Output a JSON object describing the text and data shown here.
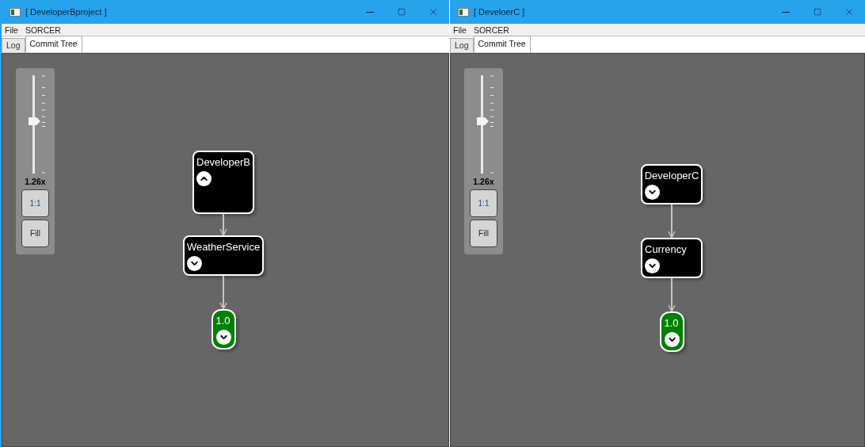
{
  "windows": [
    {
      "title": "[ DeveloperBproject ]",
      "menu": [
        "File",
        "SORCER"
      ],
      "tabs": [
        {
          "label": "Log",
          "selected": false
        },
        {
          "label": "Commit Tree",
          "selected": true
        }
      ],
      "zoom": {
        "level": 0.53,
        "reading": "1.26x",
        "buttons": [
          "1:1",
          "Fill"
        ]
      },
      "nodes": [
        {
          "kind": "branch",
          "label": "DeveloperB",
          "expanded": true
        },
        {
          "kind": "branch",
          "label": "WeatherService",
          "expanded": false
        },
        {
          "kind": "version",
          "label": "1.0",
          "expanded": false
        }
      ]
    },
    {
      "title": "[ DeveloerC ]",
      "menu": [
        "File",
        "SORCER"
      ],
      "tabs": [
        {
          "label": "Log",
          "selected": false
        },
        {
          "label": "Commit Tree",
          "selected": true
        }
      ],
      "zoom": {
        "level": 0.53,
        "reading": "1.26x",
        "buttons": [
          "1:1",
          "Fill"
        ]
      },
      "nodes": [
        {
          "kind": "branch",
          "label": "DeveloperC",
          "expanded": false
        },
        {
          "kind": "branch",
          "label": "Currency",
          "expanded": false
        },
        {
          "kind": "version",
          "label": "1.0",
          "expanded": false
        }
      ]
    }
  ]
}
